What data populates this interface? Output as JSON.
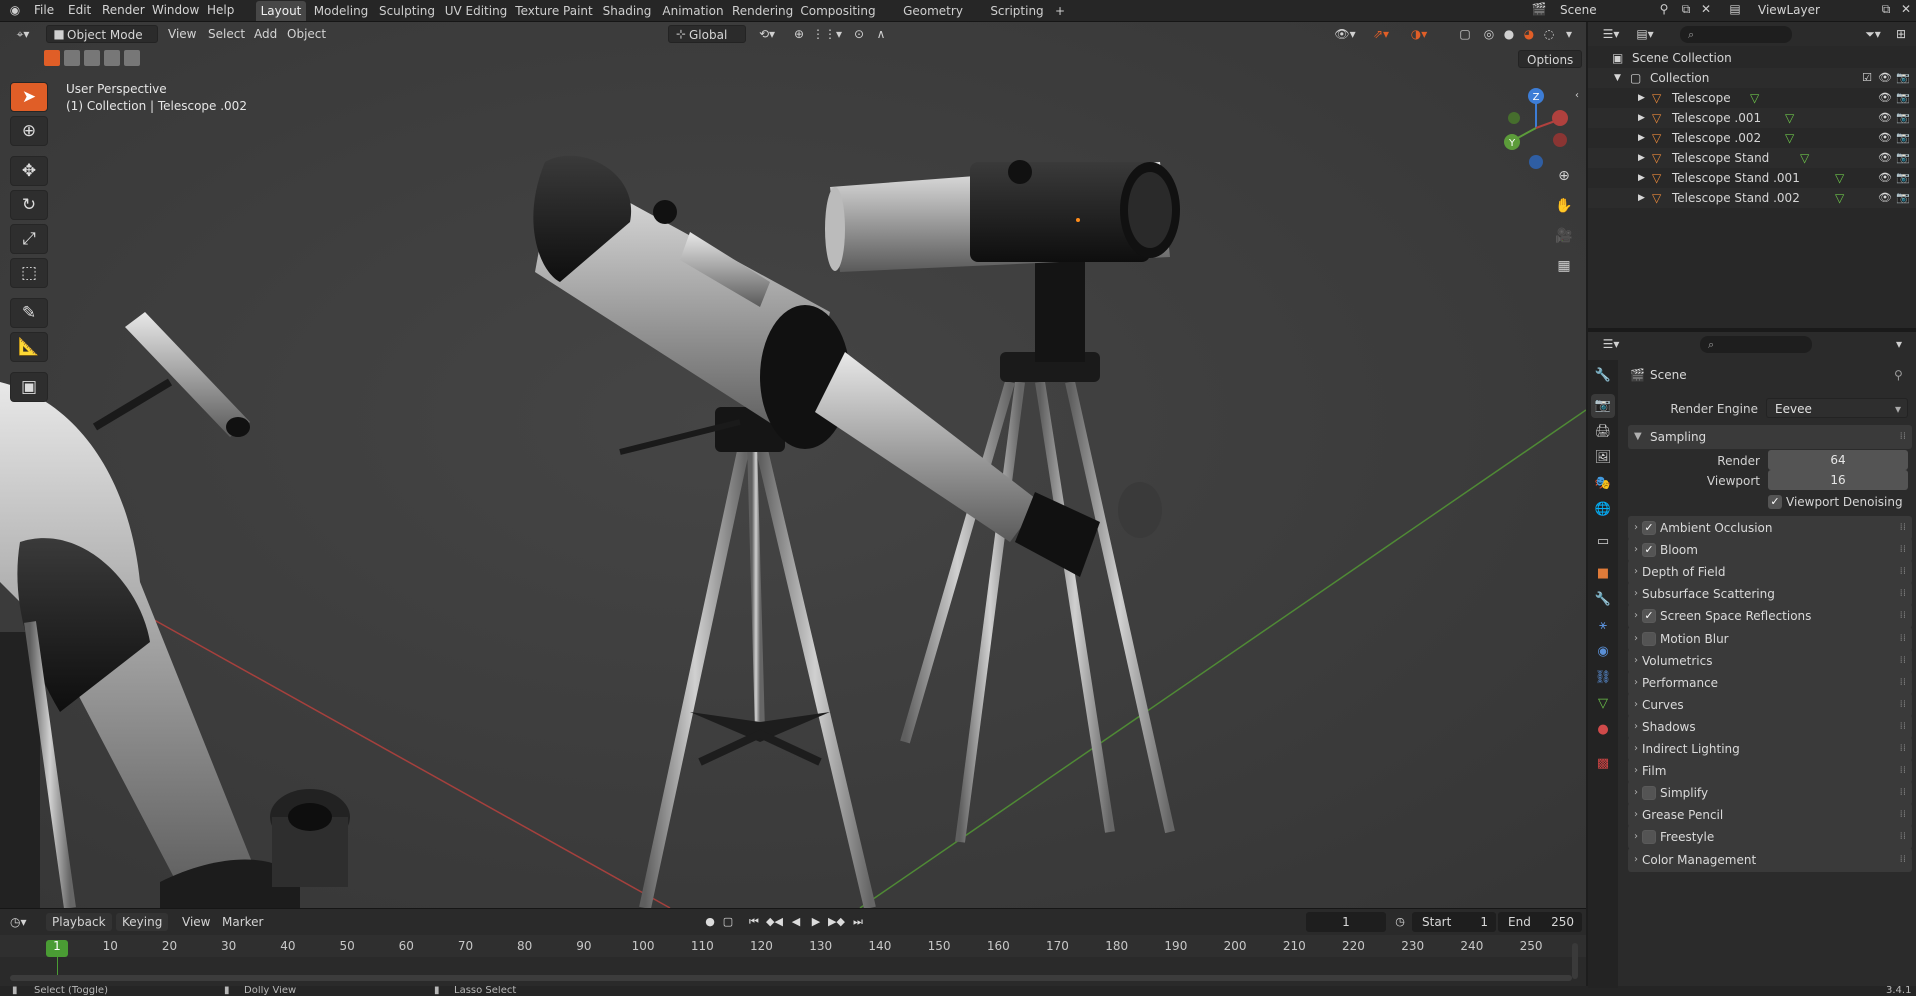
{
  "topbar": {
    "menus": [
      "File",
      "Edit",
      "Render",
      "Window",
      "Help"
    ],
    "workspaces": [
      "Layout",
      "Modeling",
      "Sculpting",
      "UV Editing",
      "Texture Paint",
      "Shading",
      "Animation",
      "Rendering",
      "Compositing",
      "Geometry Nodes",
      "Scripting"
    ],
    "active_workspace": "Layout",
    "add_workspace": "+",
    "scene_name": "Scene",
    "view_layer": "ViewLayer"
  },
  "viewport": {
    "mode": "Object Mode",
    "menus": [
      "View",
      "Select",
      "Add",
      "Object"
    ],
    "orientation": "Global",
    "options_label": "Options",
    "perspective_label": "User Perspective",
    "collection_label": "(1) Collection | Telescope .002",
    "gizmo_axes": [
      "Z",
      "Y",
      "X"
    ]
  },
  "timeline": {
    "playback_label": "Playback",
    "keying_label": "Keying",
    "view_label": "View",
    "marker_label": "Marker",
    "current_frame": "1",
    "start_label": "Start",
    "start_value": "1",
    "end_label": "End",
    "end_value": "250",
    "frame_numbers": [
      "1",
      "10",
      "20",
      "30",
      "40",
      "50",
      "60",
      "70",
      "80",
      "90",
      "100",
      "110",
      "120",
      "130",
      "140",
      "150",
      "160",
      "170",
      "180",
      "190",
      "200",
      "210",
      "220",
      "230",
      "240",
      "250"
    ]
  },
  "statusbar": {
    "items": [
      "Select (Toggle)",
      "Dolly View",
      "Lasso Select"
    ],
    "version": "3.4.1"
  },
  "outliner": {
    "root": "Scene Collection",
    "collection": "Collection",
    "objects": [
      "Telescope",
      "Telescope .001",
      "Telescope .002",
      "Telescope  Stand",
      "Telescope  Stand .001",
      "Telescope  Stand .002"
    ]
  },
  "properties": {
    "context_label": "Scene",
    "render_engine_label": "Render Engine",
    "render_engine_value": "Eevee",
    "sampling_label": "Sampling",
    "render_label": "Render",
    "render_value": "64",
    "viewport_label": "Viewport",
    "viewport_value": "16",
    "viewport_denoising_label": "Viewport Denoising",
    "viewport_denoising_checked": true,
    "panels": [
      {
        "label": "Ambient Occlusion",
        "checkbox": true,
        "checked": true
      },
      {
        "label": "Bloom",
        "checkbox": true,
        "checked": true
      },
      {
        "label": "Depth of Field",
        "checkbox": false
      },
      {
        "label": "Subsurface Scattering",
        "checkbox": false
      },
      {
        "label": "Screen Space Reflections",
        "checkbox": true,
        "checked": true
      },
      {
        "label": "Motion Blur",
        "checkbox": true,
        "checked": false
      },
      {
        "label": "Volumetrics",
        "checkbox": false
      },
      {
        "label": "Performance",
        "checkbox": false
      },
      {
        "label": "Curves",
        "checkbox": false
      },
      {
        "label": "Shadows",
        "checkbox": false
      },
      {
        "label": "Indirect Lighting",
        "checkbox": false
      },
      {
        "label": "Film",
        "checkbox": false
      },
      {
        "label": "Simplify",
        "checkbox": true,
        "checked": false
      },
      {
        "label": "Grease Pencil",
        "checkbox": false
      },
      {
        "label": "Freestyle",
        "checkbox": true,
        "checked": false
      },
      {
        "label": "Color Management",
        "checkbox": false
      }
    ]
  },
  "colors": {
    "accent": "#e05e27",
    "x_axis": "#b0413e",
    "y_axis": "#5c9c3a",
    "z_axis": "#3d7dd6",
    "current_frame": "#4a9c34"
  }
}
